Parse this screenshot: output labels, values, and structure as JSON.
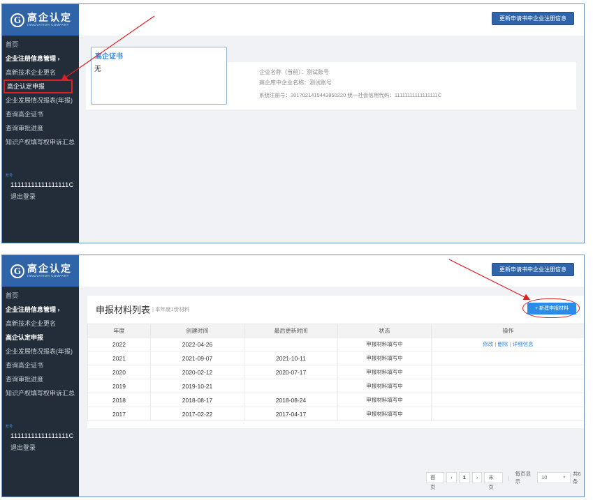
{
  "brand": {
    "logo_mark": "G",
    "name_cn": "高企认定",
    "name_en": "INNOVATION COMPANY"
  },
  "sidebar": {
    "items": [
      {
        "label": "首页"
      },
      {
        "label": "企业注册信息管理 ›"
      },
      {
        "label": "高新技术企业更名"
      },
      {
        "label": "高企认定申报"
      },
      {
        "label": "企业发展情况报表(年报)"
      },
      {
        "label": "查询高企证书"
      },
      {
        "label": "查询审批进度"
      },
      {
        "label": "知识产权填写权申诉汇总"
      }
    ],
    "account_label": "账号:",
    "account_value": "11111111111111111C",
    "logout": "退出登录"
  },
  "top_button": "更新申请书中企业注册信息",
  "screen1": {
    "cert_title": "高企证书",
    "cert_value": "无",
    "company_current": "企业名称（当前）：测试账号",
    "company_db": "高企库中企业名称：测试账号",
    "reg_line": "系统注册号：20170214154438502​20    统一社会信用代码：11111111111111111C"
  },
  "screen2": {
    "panel_title": "申报材料列表",
    "panel_sub": "| 本年度1份材料",
    "new_button": "+ 新建申报材料",
    "columns": [
      "年度",
      "创建时间",
      "最后更新时间",
      "状态",
      "操作"
    ],
    "rows": [
      {
        "year": "2022",
        "created": "2022-04-26",
        "updated": "",
        "status": "申报材料填写中",
        "ops": true
      },
      {
        "year": "2021",
        "created": "2021-09-07",
        "updated": "2021-10-11",
        "status": "申报材料填写中",
        "ops": false
      },
      {
        "year": "2020",
        "created": "2020-02-12",
        "updated": "2020-07-17",
        "status": "申报材料填写中",
        "ops": false
      },
      {
        "year": "2019",
        "created": "2019-10-21",
        "updated": "",
        "status": "申报材料填写中",
        "ops": false
      },
      {
        "year": "2018",
        "created": "2018-08-17",
        "updated": "2018-08-24",
        "status": "申报材料填写中",
        "ops": false
      },
      {
        "year": "2017",
        "created": "2017-02-22",
        "updated": "2017-04-17",
        "status": "申报材料填写中",
        "ops": false
      }
    ],
    "op_edit": "修改",
    "op_delete": "删除",
    "op_detail": "详细信息",
    "pager": {
      "first": "首页",
      "prev": "‹",
      "current": "1",
      "next": "›",
      "last": "末页",
      "per_page_label": "每页显示",
      "per_page": "10",
      "total": "共6条"
    }
  },
  "colors": {
    "sidebar_bg": "#222d39",
    "brand_blue": "#2f64a8",
    "accent_blue": "#2b8be6",
    "highlight_red": "#e02020"
  }
}
